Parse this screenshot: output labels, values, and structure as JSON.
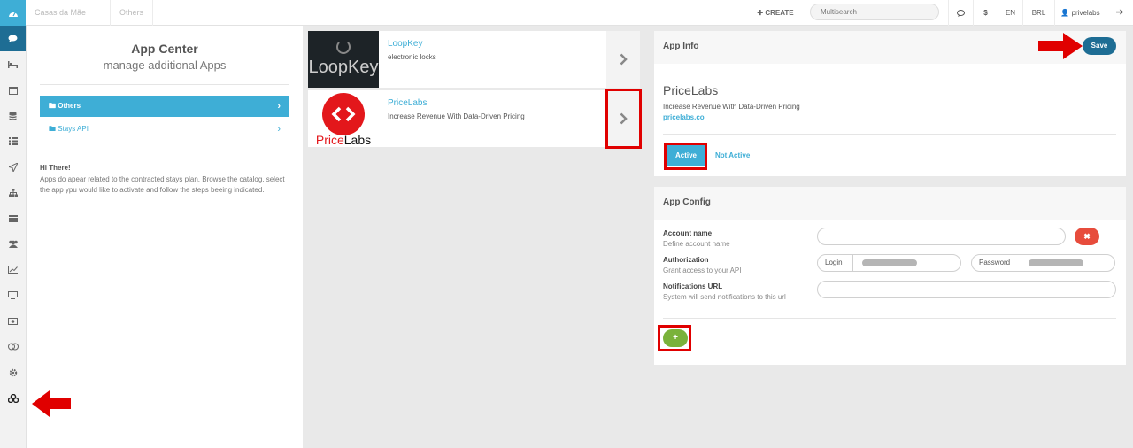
{
  "topbar": {
    "breadcrumb_property": "Casas da Mãe Joana",
    "breadcrumb_section": "Others",
    "create_label": "CREATE",
    "search_placeholder": "Multisearch",
    "currency_symbol": "$",
    "language": "EN",
    "currency": "BRL",
    "user": "privelabs"
  },
  "sidebar_icons": [
    "dashboard-icon",
    "chat-icon",
    "bed-icon",
    "calendar-icon",
    "database-icon",
    "list-icon",
    "send-icon",
    "sitemap-icon",
    "rows-icon",
    "users-icon",
    "chart-line-icon",
    "monitor-icon",
    "money-icon",
    "rings-icon",
    "gear-icon",
    "apps-icon"
  ],
  "app_center": {
    "title": "App Center",
    "subtitle": "manage additional Apps",
    "categories": [
      {
        "label": "Others"
      },
      {
        "label": "Stays API"
      }
    ],
    "greeting": "Hi There!",
    "description": "Apps do apear related to the contracted stays plan. Browse the catalog, select the app ypu would like to activate and follow the steps beeing indicated."
  },
  "apps": [
    {
      "name": "LoopKey",
      "description": "electronic locks",
      "logo_text": "LoopKey"
    },
    {
      "name": "PriceLabs",
      "description": "Increase Revenue With Data-Driven Pricing",
      "logo_text_a": "Price",
      "logo_text_b": "Labs"
    }
  ],
  "app_info": {
    "title": "App Info",
    "save_label": "Save",
    "name": "PriceLabs",
    "description": "Increase Revenue With Data-Driven Pricing",
    "link": "pricelabs.co",
    "active_label": "Active",
    "not_active_label": "Not Active"
  },
  "app_config": {
    "title": "App Config",
    "account_label": "Account name",
    "account_hint": "Define account name",
    "auth_label": "Authorization",
    "auth_hint": "Grant access to your API",
    "login_label": "Login",
    "password_label": "Password",
    "notif_label": "Notifications URL",
    "notif_hint": "System will send notifications to this url",
    "remove_symbol": "✖",
    "add_symbol": "+"
  },
  "colors": {
    "accent": "#3eaed6",
    "primary_dark": "#1e6d94",
    "danger": "#e74c3c",
    "success": "#7ab23a",
    "highlight": "#e00000"
  }
}
